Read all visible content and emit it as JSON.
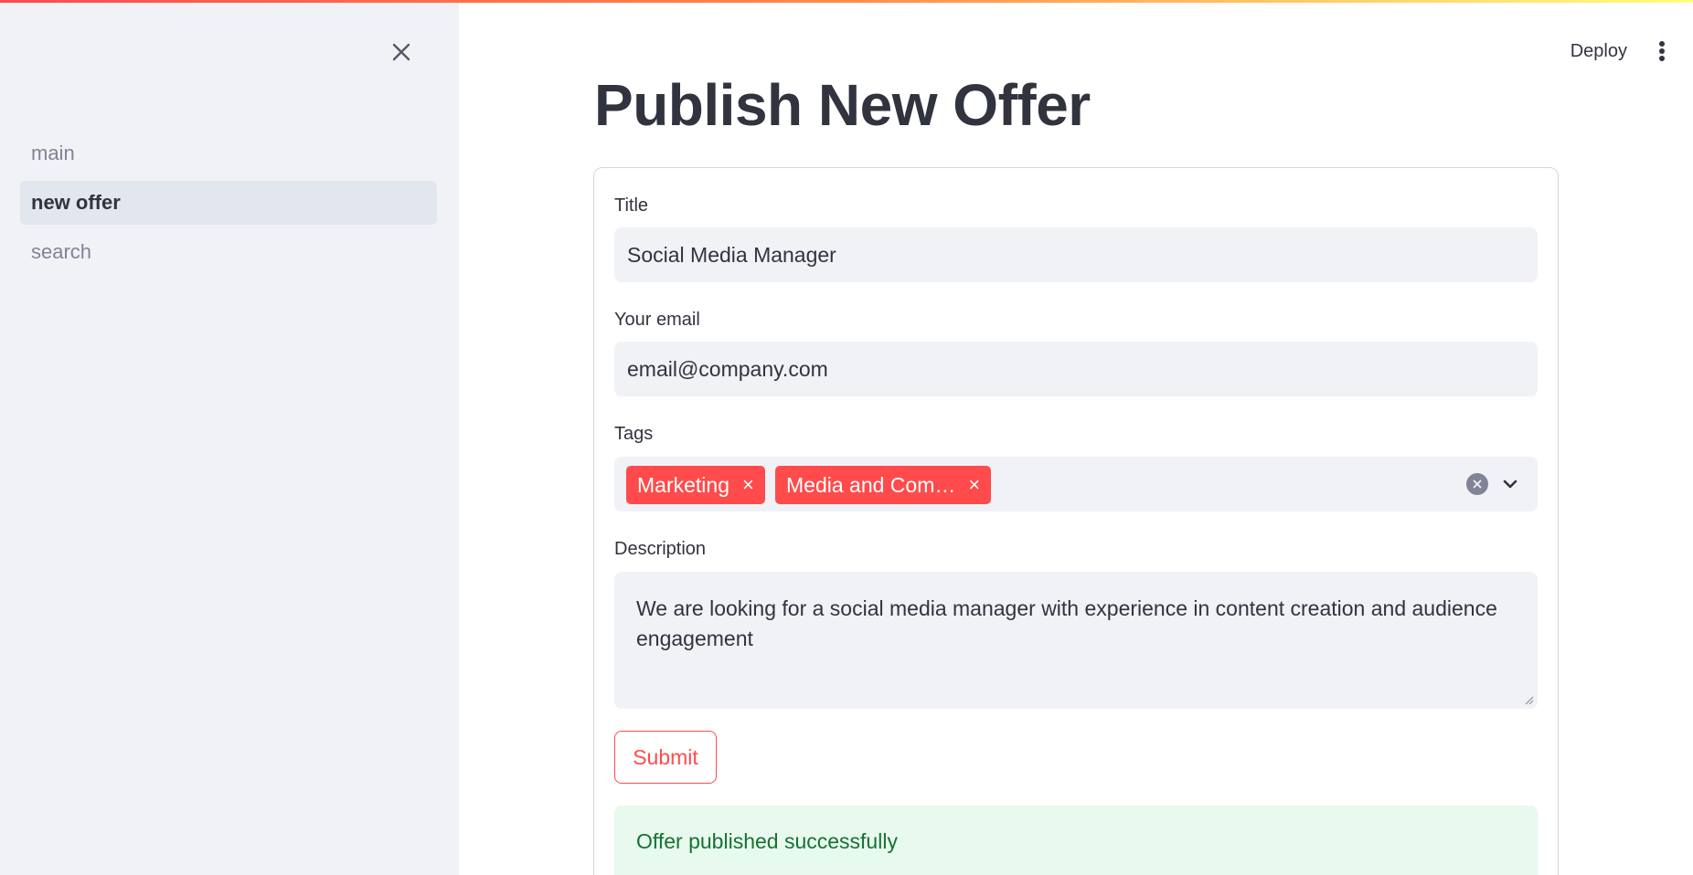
{
  "sidebar": {
    "items": [
      {
        "label": "main"
      },
      {
        "label": "new offer"
      },
      {
        "label": "search"
      }
    ]
  },
  "header": {
    "deploy_label": "Deploy"
  },
  "page": {
    "title": "Publish New Offer"
  },
  "form": {
    "title_label": "Title",
    "title_value": "Social Media Manager",
    "email_label": "Your email",
    "email_value": "email@company.com",
    "tags_label": "Tags",
    "tags": [
      "Marketing",
      "Media and Com…"
    ],
    "description_label": "Description",
    "description_value": "We are looking for a social media manager with experience in content creation and audience engagement",
    "submit_label": "Submit",
    "success_message": "Offer published successfully"
  },
  "colors": {
    "accent": "#ff4b4b",
    "sidebar_bg": "#f0f2f6",
    "success_bg": "#e8f9ee",
    "success_text": "#177233"
  }
}
